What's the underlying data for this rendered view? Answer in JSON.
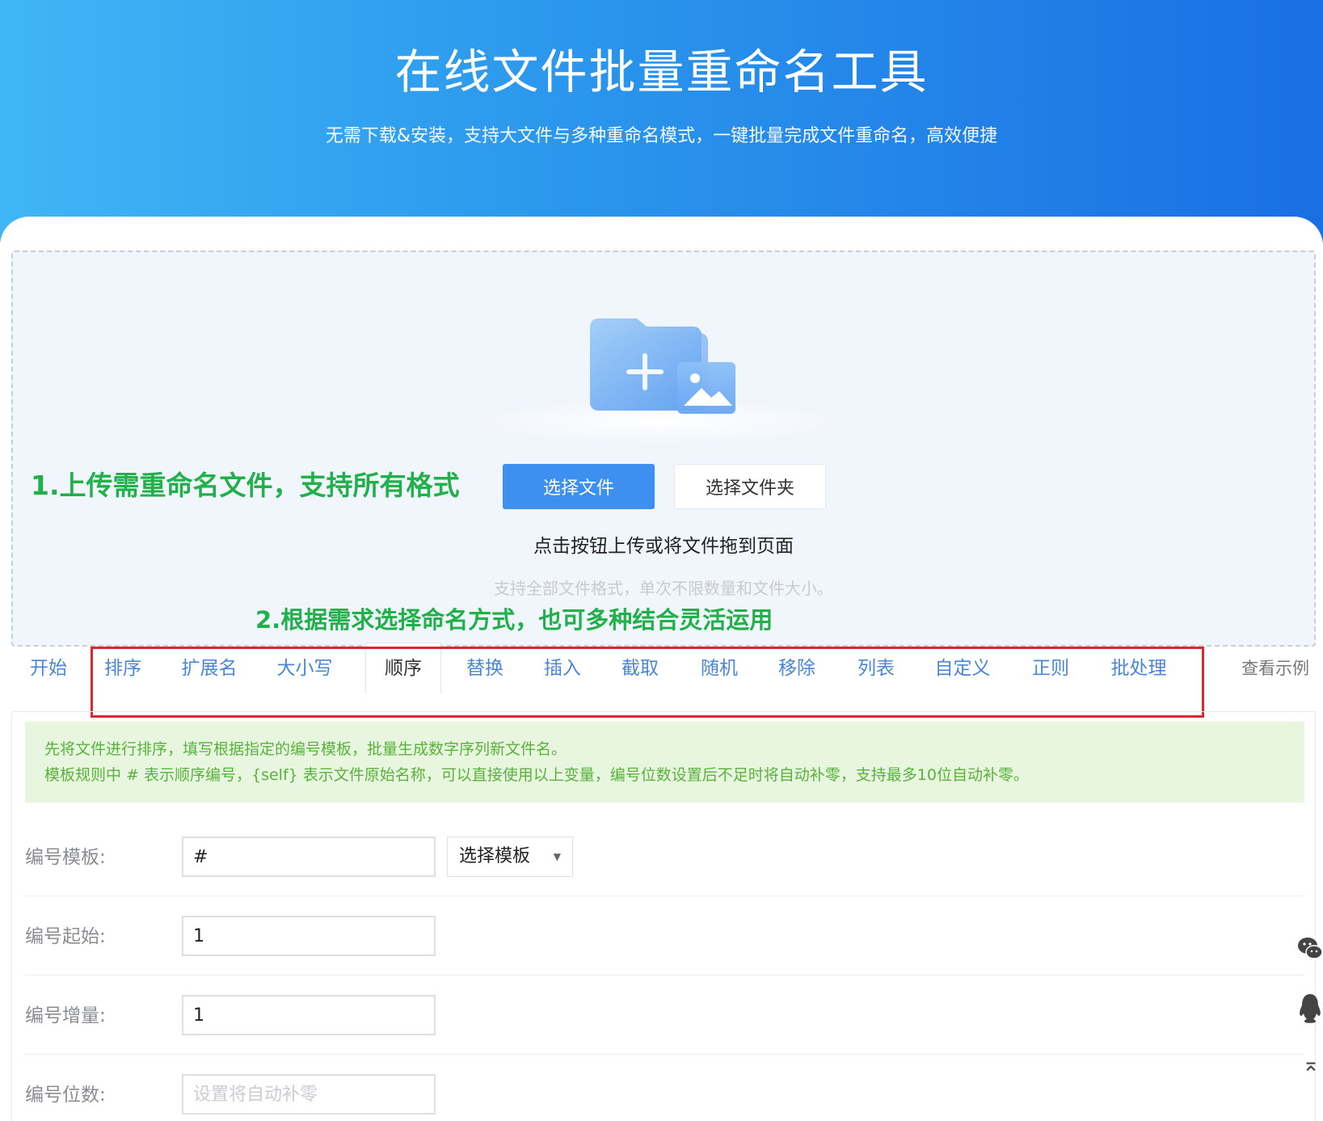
{
  "header": {
    "title": "在线文件批量重命名工具",
    "subtitle": "无需下载&安装，支持大文件与多种重命名模式，一键批量完成文件重命名，高效便捷"
  },
  "upload": {
    "step1_text": "1.上传需重命名文件，支持所有格式",
    "select_files_label": "选择文件",
    "select_folder_label": "选择文件夹",
    "hint": "点击按钮上传或将文件拖到页面",
    "subhint": "支持全部文件格式，单次不限数量和文件大小。",
    "step2_text": "2.根据需求选择命名方式，也可多种结合灵活运用"
  },
  "tabs": {
    "items": [
      {
        "label": "开始"
      },
      {
        "label": "排序"
      },
      {
        "label": "扩展名"
      },
      {
        "label": "大小写"
      },
      {
        "label": "顺序"
      },
      {
        "label": "替换"
      },
      {
        "label": "插入"
      },
      {
        "label": "截取"
      },
      {
        "label": "随机"
      },
      {
        "label": "移除"
      },
      {
        "label": "列表"
      },
      {
        "label": "自定义"
      },
      {
        "label": "正则"
      },
      {
        "label": "批处理"
      }
    ],
    "active": "顺序",
    "example_label": "查看示例"
  },
  "notice": {
    "line1": "先将文件进行排序，填写根据指定的编号模板，批量生成数字序列新文件名。",
    "line2": "模板规则中 # 表示顺序编号，{self} 表示文件原始名称，可以直接使用以上变量，编号位数设置后不足时将自动补零，支持最多10位自动补零。"
  },
  "form": {
    "template_label": "编号模板:",
    "template_value": "#",
    "template_select": "选择模板",
    "start_label": "编号起始:",
    "start_value": "1",
    "increment_label": "编号增量:",
    "increment_value": "1",
    "digits_label": "编号位数:",
    "digits_placeholder": "设置将自动补零"
  },
  "colors": {
    "header_gradient_start": "#3fb6f5",
    "header_gradient_end": "#1a6fe3",
    "primary_button": "#3d8ff0",
    "step_annotation": "#21b04a",
    "annotation_box": "#d9282f",
    "tab_link": "#4a86d8",
    "notice_bg": "#e8f6df",
    "notice_text": "#58b23b"
  },
  "icons": {
    "upload_illustration": "folder-plus-image-icon",
    "wechat": "wechat-icon",
    "qq": "qq-icon",
    "back_to_top": "back-to-top-icon"
  }
}
